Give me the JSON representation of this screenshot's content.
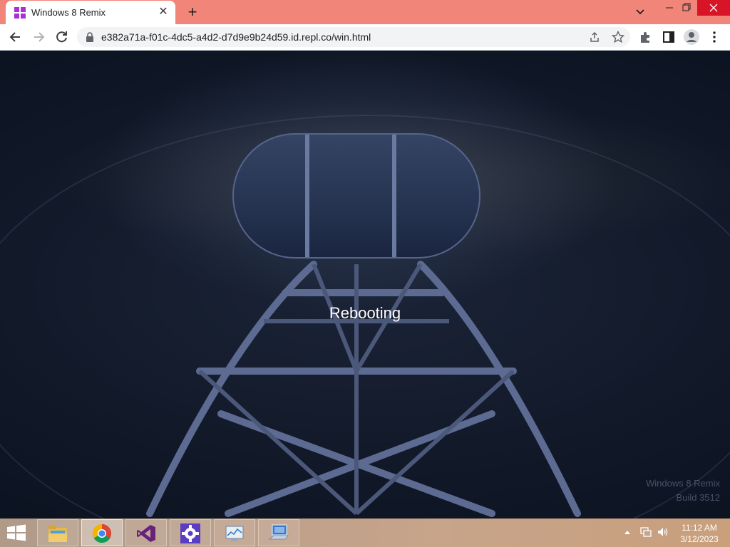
{
  "browser": {
    "tab_title": "Windows 8 Remix",
    "url": "e382a71a-f01c-4dc5-a4d2-d7d9e9b24d59.id.repl.co/win.html",
    "tabstrip_color": "#f2857a"
  },
  "desktop": {
    "status_text": "Rebooting",
    "watermark_line1": "Windows 8 Remix",
    "watermark_line2": "Build 3512"
  },
  "taskbar": {
    "items": [
      {
        "name": "file-explorer",
        "icon": "folder-icon",
        "active": false
      },
      {
        "name": "chrome",
        "icon": "chrome-icon",
        "active": true
      },
      {
        "name": "visual-studio",
        "icon": "visual-studio-icon",
        "active": false
      },
      {
        "name": "settings",
        "icon": "gear-icon",
        "active": false
      },
      {
        "name": "task-manager",
        "icon": "monitor-chart-icon",
        "active": false
      },
      {
        "name": "remote-desktop",
        "icon": "computer-keyboard-icon",
        "active": false
      }
    ],
    "clock_time": "11:12 AM",
    "clock_date": "3/12/2023"
  }
}
